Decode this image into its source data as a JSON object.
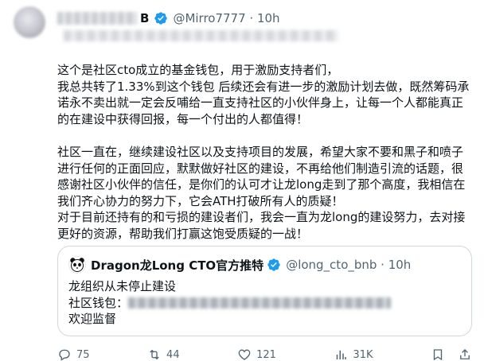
{
  "author": {
    "name_suffix": "B",
    "handle": "@Mirro7777 · 10h"
  },
  "body": {
    "p1": "这个是社区cto成立的基金钱包，用于激励支持者们，\n我总共转了1.33%到这个钱包 后续还会有进一步的激励计划去做，既然筹码承诺永不卖出就一定会反哺给一直支持社区的小伙伴身上，让每一个人都能真正的在建设中获得回报，每一个付出的人都值得！",
    "p2": "社区一直在，继续建设社区以及支持项目的发展，希望大家不要和黑子和喷子进行任何的正面回应，默默做好社区的建设，不再给他们制造引流的话题，很感谢社区小伙伴的信任，是你们的认可才让龙long走到了那个高度，我相信在我们齐心协力的努力下，它会ATH打破所有人的质疑！\n对于目前还持有的和亏损的建设者们，我会一直为龙long的建设努力，去对接更好的资源，帮助我们打赢这饱受质疑的一战！"
  },
  "quote": {
    "name": "Dragon龙Long CTO官方推特",
    "handle": "@long_cto_bnb · 10h",
    "line1": "龙组织从未停止建设",
    "line2_label": "社区钱包：",
    "line3": "欢迎监督"
  },
  "actions": {
    "replies": "75",
    "reposts": "44",
    "likes": "121",
    "views": "31K"
  },
  "colors": {
    "verified_blue": "#1d9bf0",
    "muted_text": "#536471",
    "border": "#cfd9de"
  }
}
